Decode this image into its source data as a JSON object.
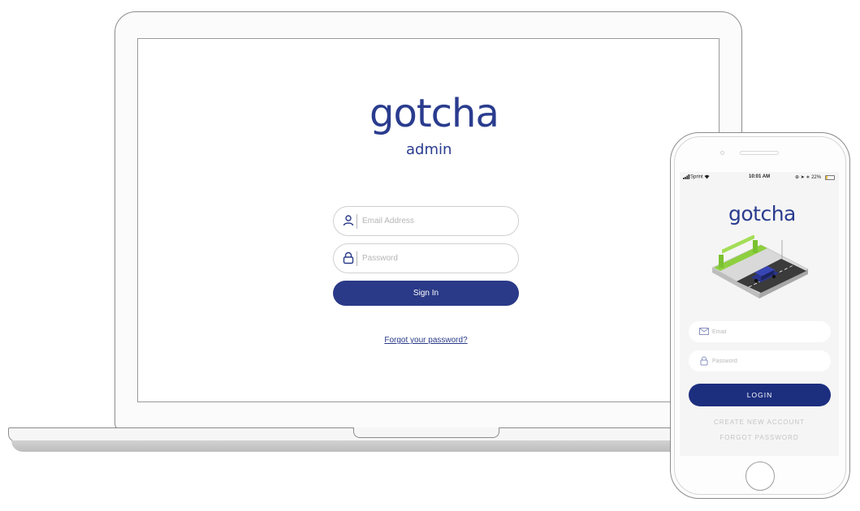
{
  "laptop": {
    "logo": {
      "word": "gotcha",
      "subtitle": "admin",
      "color": "#2a3c8e"
    },
    "form": {
      "email_placeholder": "Email Address",
      "password_placeholder": "Password",
      "icons": {
        "email": "user-icon",
        "password": "lock-icon"
      },
      "signin_label": "Sign In",
      "forgot_label": "Forgot your password?"
    },
    "accent_color": "#2a3a88"
  },
  "phone": {
    "status_bar": {
      "carrier": "Sprint",
      "time": "10:01 AM",
      "battery_percent": "22%",
      "battery_level": 0.22
    },
    "logo": {
      "word": "gotcha"
    },
    "illustration": "isometric-parking-street-illustration",
    "form": {
      "email_placeholder": "Email",
      "password_placeholder": "Password",
      "icons": {
        "email": "envelope-icon",
        "password": "lock-icon"
      },
      "login_label": "LOGIN",
      "create_account_label": "CREATE NEW ACCOUNT",
      "forgot_label": "FORGOT PASSWORD"
    },
    "accent_color": "#1c2e7e"
  }
}
